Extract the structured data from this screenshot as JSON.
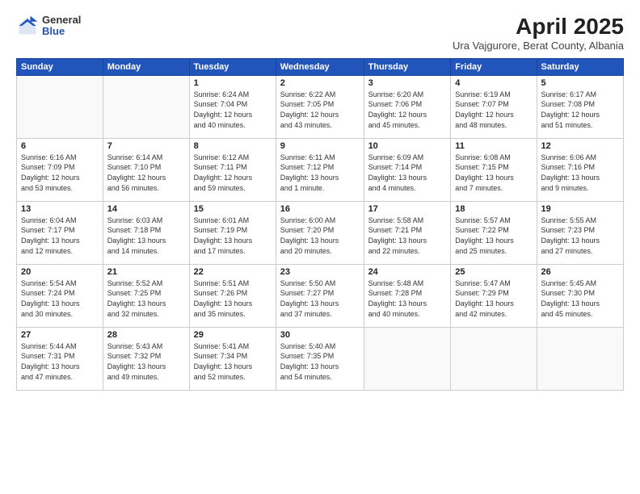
{
  "logo": {
    "general": "General",
    "blue": "Blue"
  },
  "title": "April 2025",
  "location": "Ura Vajgurore, Berat County, Albania",
  "days_header": [
    "Sunday",
    "Monday",
    "Tuesday",
    "Wednesday",
    "Thursday",
    "Friday",
    "Saturday"
  ],
  "weeks": [
    [
      {
        "day": "",
        "info": ""
      },
      {
        "day": "",
        "info": ""
      },
      {
        "day": "1",
        "info": "Sunrise: 6:24 AM\nSunset: 7:04 PM\nDaylight: 12 hours\nand 40 minutes."
      },
      {
        "day": "2",
        "info": "Sunrise: 6:22 AM\nSunset: 7:05 PM\nDaylight: 12 hours\nand 43 minutes."
      },
      {
        "day": "3",
        "info": "Sunrise: 6:20 AM\nSunset: 7:06 PM\nDaylight: 12 hours\nand 45 minutes."
      },
      {
        "day": "4",
        "info": "Sunrise: 6:19 AM\nSunset: 7:07 PM\nDaylight: 12 hours\nand 48 minutes."
      },
      {
        "day": "5",
        "info": "Sunrise: 6:17 AM\nSunset: 7:08 PM\nDaylight: 12 hours\nand 51 minutes."
      }
    ],
    [
      {
        "day": "6",
        "info": "Sunrise: 6:16 AM\nSunset: 7:09 PM\nDaylight: 12 hours\nand 53 minutes."
      },
      {
        "day": "7",
        "info": "Sunrise: 6:14 AM\nSunset: 7:10 PM\nDaylight: 12 hours\nand 56 minutes."
      },
      {
        "day": "8",
        "info": "Sunrise: 6:12 AM\nSunset: 7:11 PM\nDaylight: 12 hours\nand 59 minutes."
      },
      {
        "day": "9",
        "info": "Sunrise: 6:11 AM\nSunset: 7:12 PM\nDaylight: 13 hours\nand 1 minute."
      },
      {
        "day": "10",
        "info": "Sunrise: 6:09 AM\nSunset: 7:14 PM\nDaylight: 13 hours\nand 4 minutes."
      },
      {
        "day": "11",
        "info": "Sunrise: 6:08 AM\nSunset: 7:15 PM\nDaylight: 13 hours\nand 7 minutes."
      },
      {
        "day": "12",
        "info": "Sunrise: 6:06 AM\nSunset: 7:16 PM\nDaylight: 13 hours\nand 9 minutes."
      }
    ],
    [
      {
        "day": "13",
        "info": "Sunrise: 6:04 AM\nSunset: 7:17 PM\nDaylight: 13 hours\nand 12 minutes."
      },
      {
        "day": "14",
        "info": "Sunrise: 6:03 AM\nSunset: 7:18 PM\nDaylight: 13 hours\nand 14 minutes."
      },
      {
        "day": "15",
        "info": "Sunrise: 6:01 AM\nSunset: 7:19 PM\nDaylight: 13 hours\nand 17 minutes."
      },
      {
        "day": "16",
        "info": "Sunrise: 6:00 AM\nSunset: 7:20 PM\nDaylight: 13 hours\nand 20 minutes."
      },
      {
        "day": "17",
        "info": "Sunrise: 5:58 AM\nSunset: 7:21 PM\nDaylight: 13 hours\nand 22 minutes."
      },
      {
        "day": "18",
        "info": "Sunrise: 5:57 AM\nSunset: 7:22 PM\nDaylight: 13 hours\nand 25 minutes."
      },
      {
        "day": "19",
        "info": "Sunrise: 5:55 AM\nSunset: 7:23 PM\nDaylight: 13 hours\nand 27 minutes."
      }
    ],
    [
      {
        "day": "20",
        "info": "Sunrise: 5:54 AM\nSunset: 7:24 PM\nDaylight: 13 hours\nand 30 minutes."
      },
      {
        "day": "21",
        "info": "Sunrise: 5:52 AM\nSunset: 7:25 PM\nDaylight: 13 hours\nand 32 minutes."
      },
      {
        "day": "22",
        "info": "Sunrise: 5:51 AM\nSunset: 7:26 PM\nDaylight: 13 hours\nand 35 minutes."
      },
      {
        "day": "23",
        "info": "Sunrise: 5:50 AM\nSunset: 7:27 PM\nDaylight: 13 hours\nand 37 minutes."
      },
      {
        "day": "24",
        "info": "Sunrise: 5:48 AM\nSunset: 7:28 PM\nDaylight: 13 hours\nand 40 minutes."
      },
      {
        "day": "25",
        "info": "Sunrise: 5:47 AM\nSunset: 7:29 PM\nDaylight: 13 hours\nand 42 minutes."
      },
      {
        "day": "26",
        "info": "Sunrise: 5:45 AM\nSunset: 7:30 PM\nDaylight: 13 hours\nand 45 minutes."
      }
    ],
    [
      {
        "day": "27",
        "info": "Sunrise: 5:44 AM\nSunset: 7:31 PM\nDaylight: 13 hours\nand 47 minutes."
      },
      {
        "day": "28",
        "info": "Sunrise: 5:43 AM\nSunset: 7:32 PM\nDaylight: 13 hours\nand 49 minutes."
      },
      {
        "day": "29",
        "info": "Sunrise: 5:41 AM\nSunset: 7:34 PM\nDaylight: 13 hours\nand 52 minutes."
      },
      {
        "day": "30",
        "info": "Sunrise: 5:40 AM\nSunset: 7:35 PM\nDaylight: 13 hours\nand 54 minutes."
      },
      {
        "day": "",
        "info": ""
      },
      {
        "day": "",
        "info": ""
      },
      {
        "day": "",
        "info": ""
      }
    ]
  ]
}
